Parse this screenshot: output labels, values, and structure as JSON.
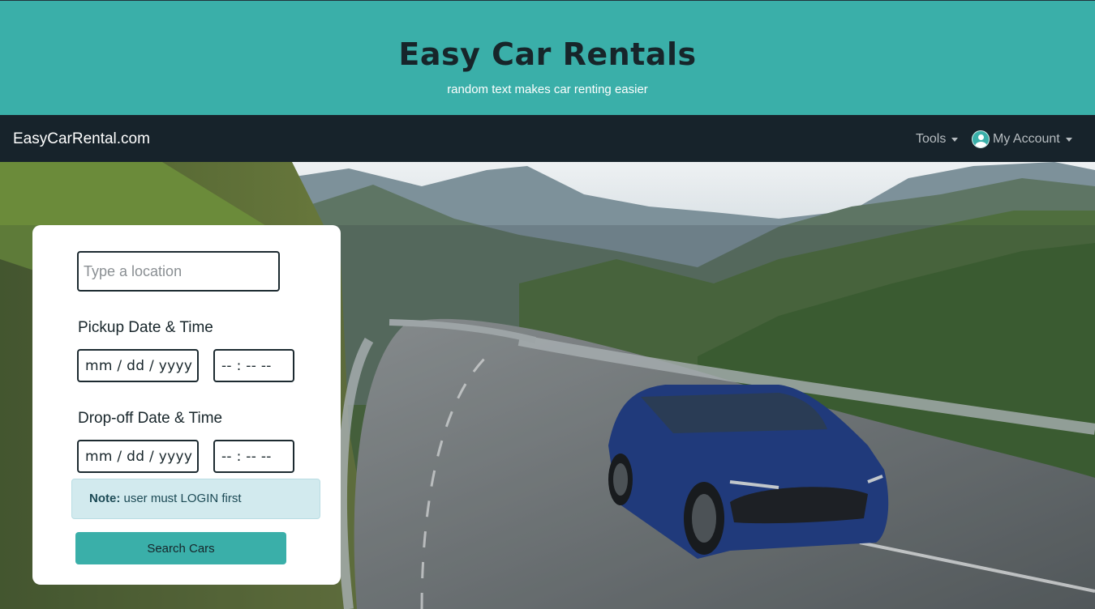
{
  "header": {
    "title": "Easy Car Rentals",
    "subtitle": "random text makes car renting easier"
  },
  "navbar": {
    "brand": "EasyCarRental.com",
    "tools_label": "Tools",
    "account_label": "My Account"
  },
  "search_form": {
    "location_placeholder": "Type a location",
    "pickup_label": "Pickup Date & Time",
    "pickup_date_placeholder": "mm / dd / yyyy",
    "pickup_time_placeholder": "-- : --  --",
    "dropoff_label": "Drop-off Date & Time",
    "dropoff_date_placeholder": "mm / dd / yyyy",
    "dropoff_time_placeholder": "-- : --  --",
    "note_prefix": "Note:",
    "note_text": "user must LOGIN first",
    "submit_label": "Search Cars"
  },
  "colors": {
    "brand_teal": "#3aafa9",
    "navbar_bg": "#17232b",
    "title_text": "#17252a"
  },
  "icons": {
    "account": "user-avatar-icon",
    "dropdown": "caret-down-icon"
  }
}
